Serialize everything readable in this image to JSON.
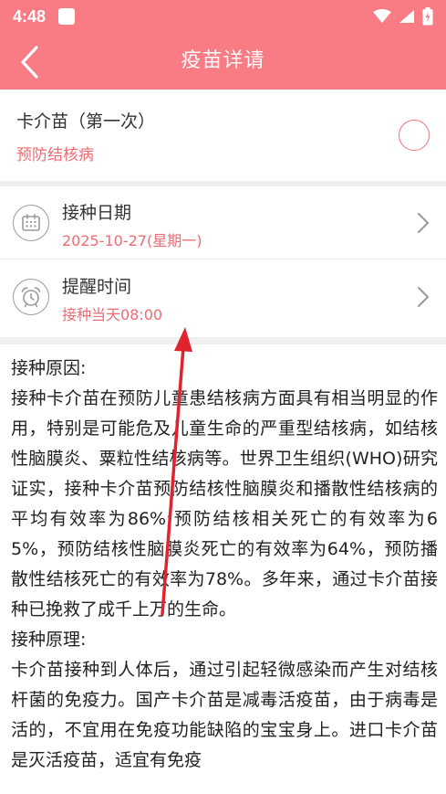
{
  "status_bar": {
    "time": "4:48",
    "icons": [
      "notification-square-icon",
      "wifi-icon",
      "signal-icon",
      "battery-charging-icon"
    ]
  },
  "header": {
    "title": "疫苗详请",
    "back_icon": "back-chevron-icon"
  },
  "vaccine": {
    "name": "卡介苗（第一次）",
    "prevents": "预防结核病",
    "selected": false
  },
  "schedule": {
    "date_label": "接种日期",
    "date_value": "2025-10-27(星期一)",
    "date_icon": "calendar-icon",
    "reminder_label": "提醒时间",
    "reminder_value": "接种当天08:00",
    "reminder_icon": "alarm-clock-icon"
  },
  "description": {
    "text": "接种原因:\n接种卡介苗在预防儿童患结核病方面具有相当明显的作用，特别是可能危及儿童生命的严重型结核病，如结核性脑膜炎、粟粒性结核病等。世界卫生组织(WHO)研究证实，接种卡介苗预防结核性脑膜炎和播散性结核病的平均有效率为86%;预防结核相关死亡的有效率为65%，预防结核性脑膜炎死亡的有效率为64%，预防播散性结核死亡的有效率为78%。多年来，通过卡介苗接种已挽救了成千上万的生命。\n接种原理:\n卡介苗接种到人体后，通过引起轻微感染而产生对结核杆菌的免疫力。国产卡介苗是减毒活疫苗，由于病毒是活的，不宜用在免疫功能缺陷的宝宝身上。进口卡介苗是灭活疫苗，适宜有免疫"
  },
  "colors": {
    "accent": "#f97b83",
    "accent_text": "#ef6b74",
    "annotation_arrow": "#e0242f"
  }
}
